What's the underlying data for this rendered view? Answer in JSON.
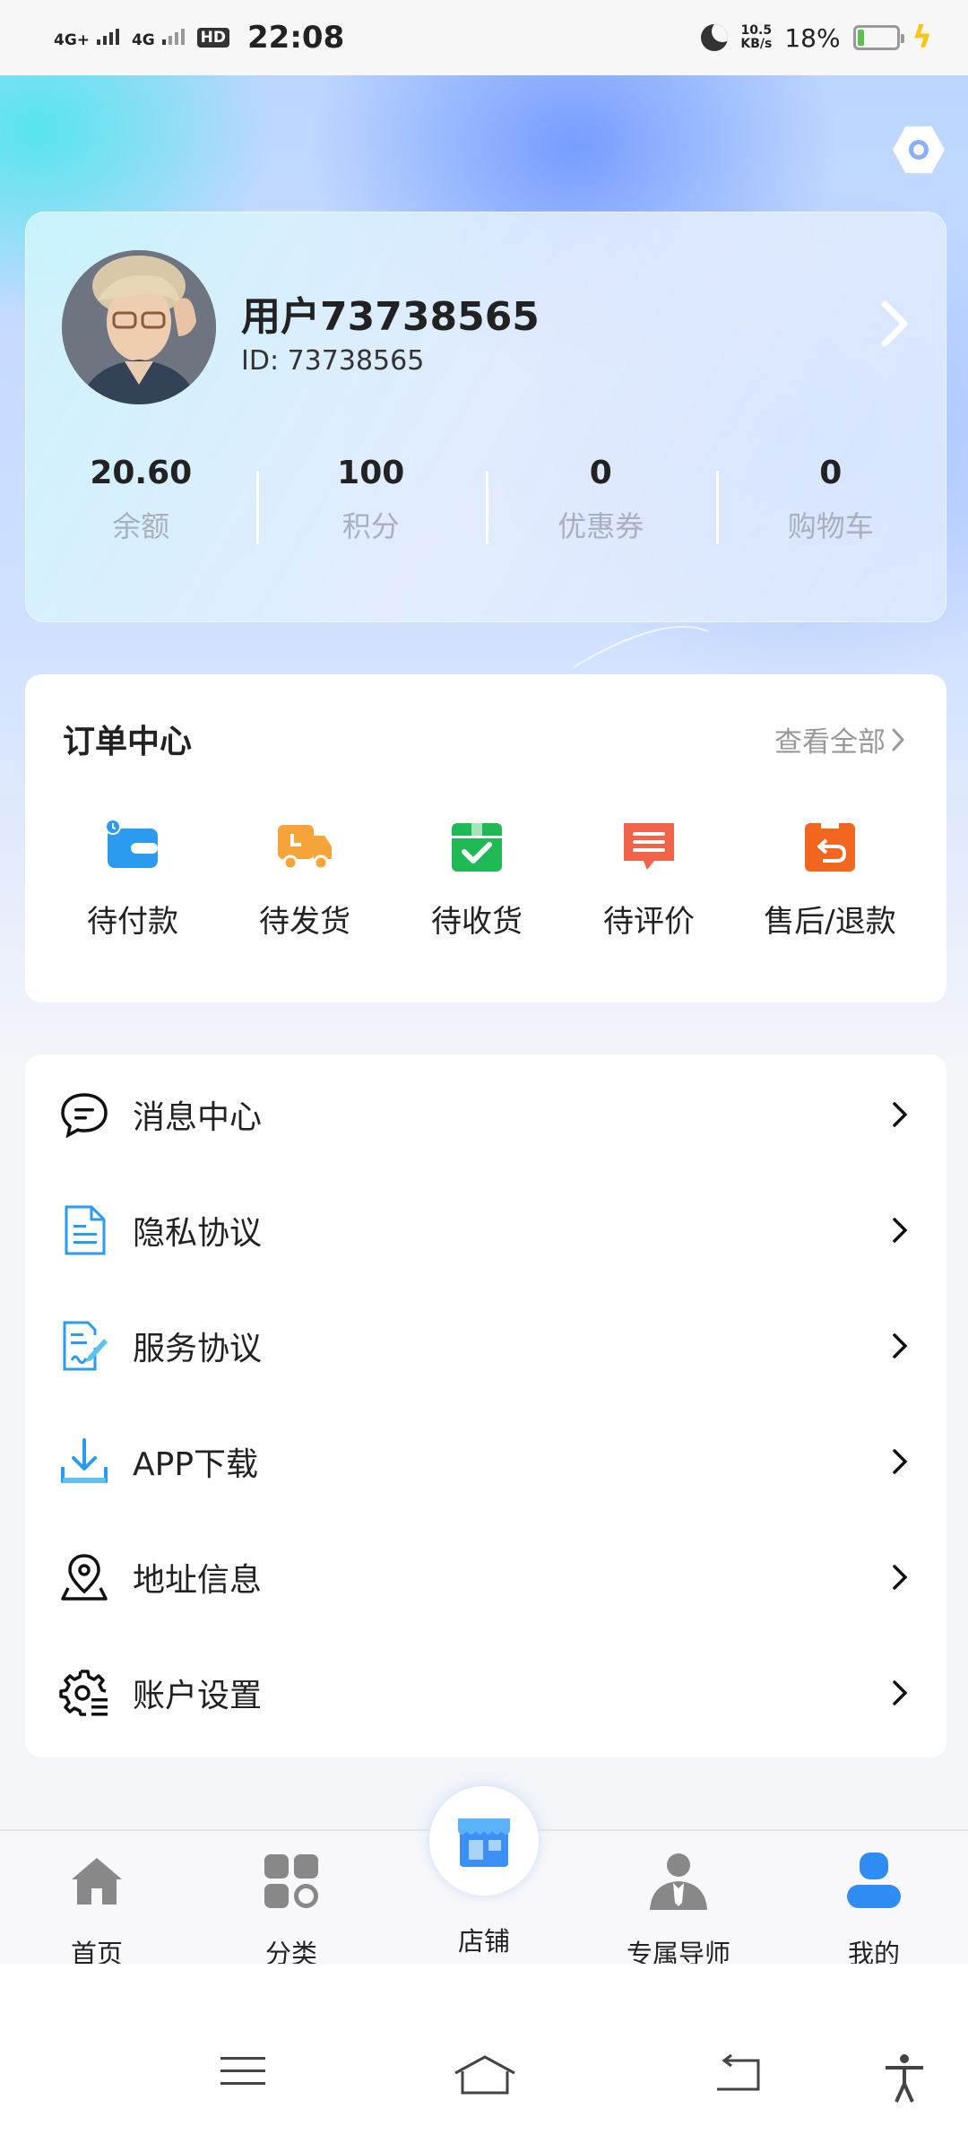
{
  "status_bar": {
    "signal1": "4G+",
    "signal2": "4G",
    "hd": "HD",
    "time": "22:08",
    "speed_value": "10.5",
    "speed_unit": "KB/s",
    "battery_pct": "18%",
    "battery_level": 0.18
  },
  "profile": {
    "username": "用户73738565",
    "user_id": "ID: 73738565",
    "stats": [
      {
        "value": "20.60",
        "label": "余额"
      },
      {
        "value": "100",
        "label": "积分"
      },
      {
        "value": "0",
        "label": "优惠券"
      },
      {
        "value": "0",
        "label": "购物车"
      }
    ]
  },
  "orders": {
    "title": "订单中心",
    "view_all": "查看全部",
    "items": [
      {
        "label": "待付款",
        "icon": "wallet-icon",
        "color": "#2b9bf0"
      },
      {
        "label": "待发货",
        "icon": "truck-icon",
        "color": "#f6a43a"
      },
      {
        "label": "待收货",
        "icon": "package-check-icon",
        "color": "#1fba55"
      },
      {
        "label": "待评价",
        "icon": "comment-icon",
        "color": "#f2644a"
      },
      {
        "label": "售后/退款",
        "icon": "refund-box-icon",
        "color": "#f2661f"
      }
    ]
  },
  "menu": {
    "items": [
      {
        "label": "消息中心",
        "icon": "message-icon"
      },
      {
        "label": "隐私协议",
        "icon": "document-icon"
      },
      {
        "label": "服务协议",
        "icon": "signed-document-icon"
      },
      {
        "label": "APP下载",
        "icon": "download-icon"
      },
      {
        "label": "地址信息",
        "icon": "location-pin-icon"
      },
      {
        "label": "账户设置",
        "icon": "gear-icon"
      }
    ]
  },
  "tab_bar": {
    "items": [
      {
        "label": "首页",
        "icon": "home-icon"
      },
      {
        "label": "分类",
        "icon": "category-icon"
      },
      {
        "label": "店铺",
        "icon": "shop-icon"
      },
      {
        "label": "专属导师",
        "icon": "mentor-icon"
      },
      {
        "label": "我的",
        "icon": "user-icon",
        "active_color": "#2f8cf5"
      }
    ]
  }
}
